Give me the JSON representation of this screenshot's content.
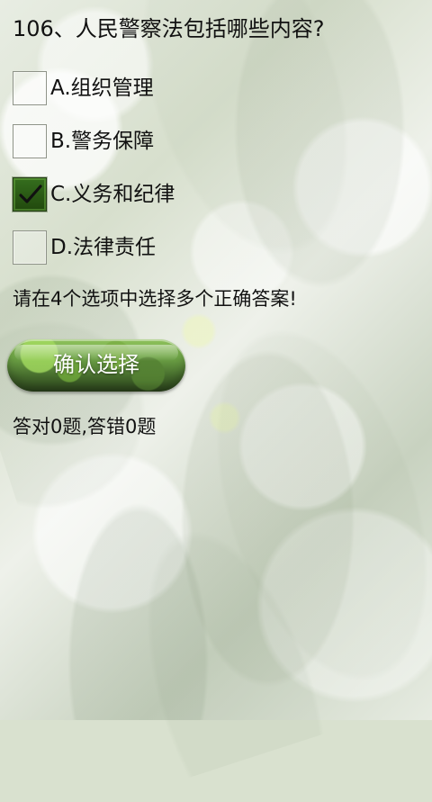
{
  "quiz": {
    "question": "106、人民警察法包括哪些内容?",
    "options": [
      {
        "label": "A.组织管理",
        "checked": false
      },
      {
        "label": "B.警务保障",
        "checked": false
      },
      {
        "label": "C.义务和纪律",
        "checked": true
      },
      {
        "label": "D.法律责任",
        "checked": false
      }
    ],
    "instruction": "请在4个选项中选择多个正确答案!",
    "confirm_button": "确认选择",
    "score": "答对0题,答错0题"
  },
  "colors": {
    "text": "#111111",
    "checkbox_selected": "#2d5c17",
    "button_green": "#6ea446"
  },
  "icons": {
    "selected_checkbox": "check-icon"
  }
}
